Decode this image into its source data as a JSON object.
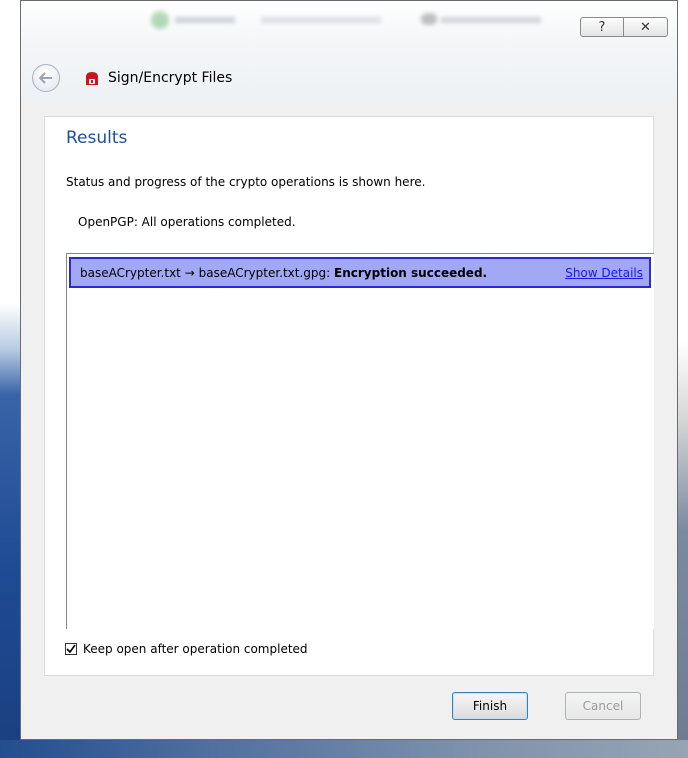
{
  "window": {
    "title": "Sign/Encrypt Files",
    "help_label": "?",
    "close_label": "✕"
  },
  "content": {
    "heading": "Results",
    "description": "Status and progress of the crypto operations is shown here.",
    "openpgp_status": "OpenPGP: All operations completed."
  },
  "results": [
    {
      "source_file": "baseACrypter.txt",
      "arrow": "→",
      "target_file": "baseACrypter.txt.gpg:",
      "status": "Encryption succeeded.",
      "details_link": "Show Details"
    }
  ],
  "options": {
    "keep_open_label": "Keep open after operation completed",
    "keep_open_checked": true
  },
  "buttons": {
    "finish": "Finish",
    "cancel": "Cancel"
  },
  "colors": {
    "heading": "#1f4f9a",
    "row_highlight": "#a3a8f5",
    "row_border": "#2b2bd6",
    "link": "#1a1aee"
  }
}
